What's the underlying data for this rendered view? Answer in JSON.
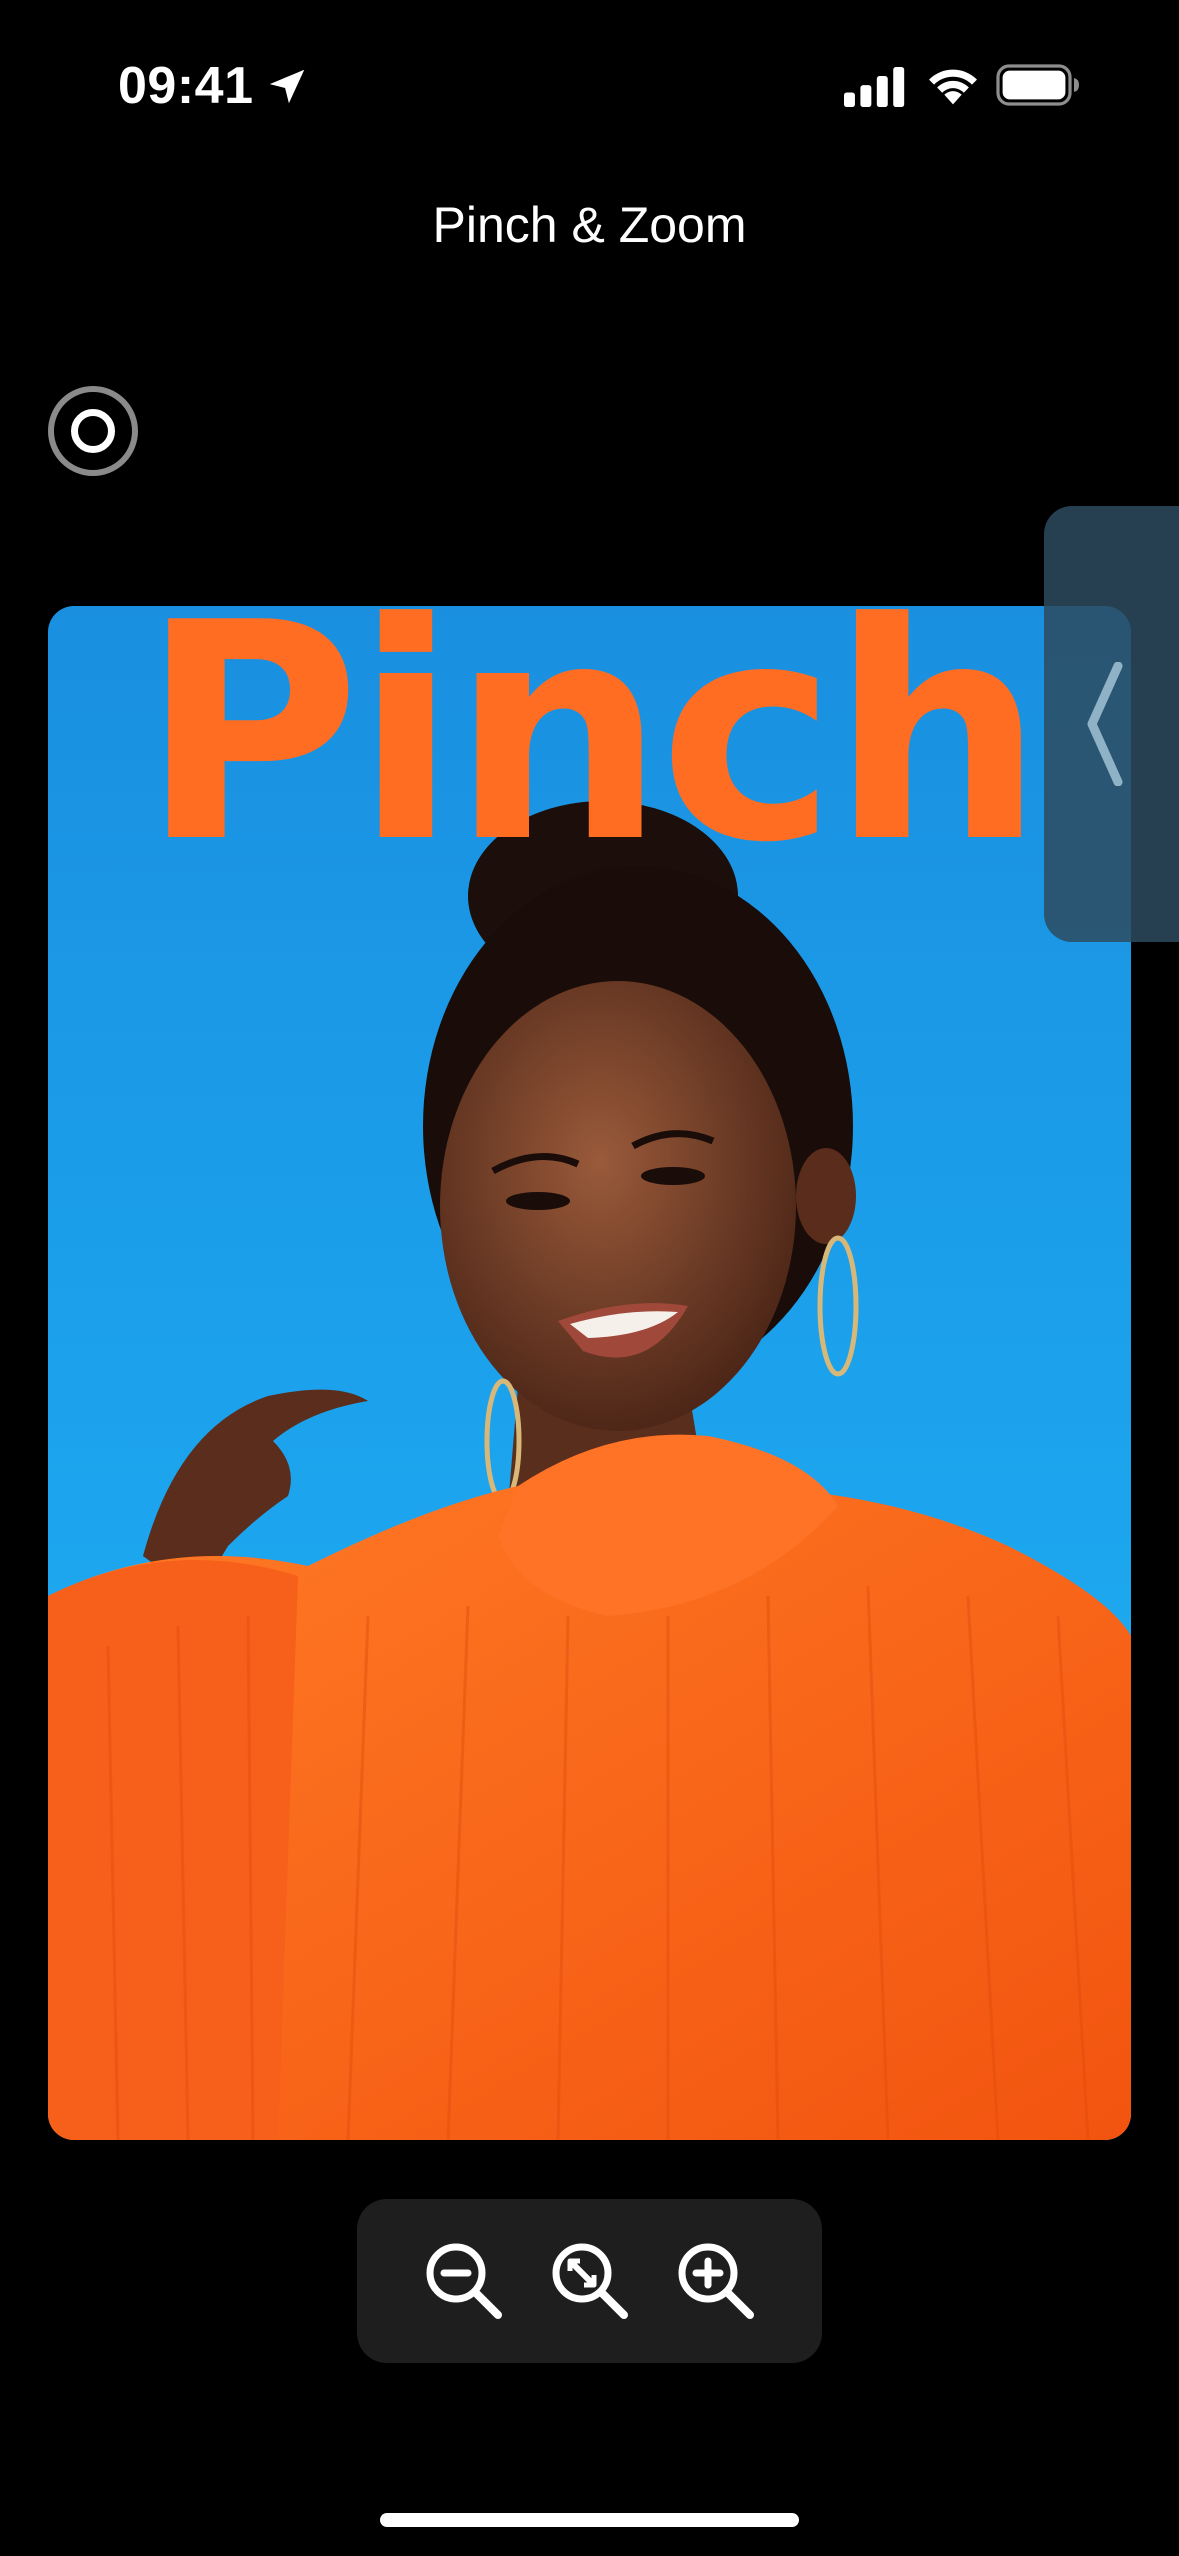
{
  "status_bar": {
    "time": "09:41",
    "icons": [
      "location-arrow-icon",
      "cellular-signal-icon",
      "wifi-icon",
      "battery-icon"
    ]
  },
  "navigation": {
    "title": "Pinch & Zoom"
  },
  "record_button": {
    "icon": "record-icon"
  },
  "photo": {
    "overlay_text": "Pinch",
    "colors": {
      "background": "#1a9ae4",
      "text": "#ff6d22",
      "sweater": "#ff6a1f"
    }
  },
  "side_panel": {
    "icon": "chevron-left-icon"
  },
  "zoom_controls": {
    "buttons": [
      "zoom-out-icon",
      "zoom-fit-icon",
      "zoom-in-icon"
    ]
  },
  "colors": {
    "background": "#000000",
    "control_bar": "#1e1e1e"
  }
}
